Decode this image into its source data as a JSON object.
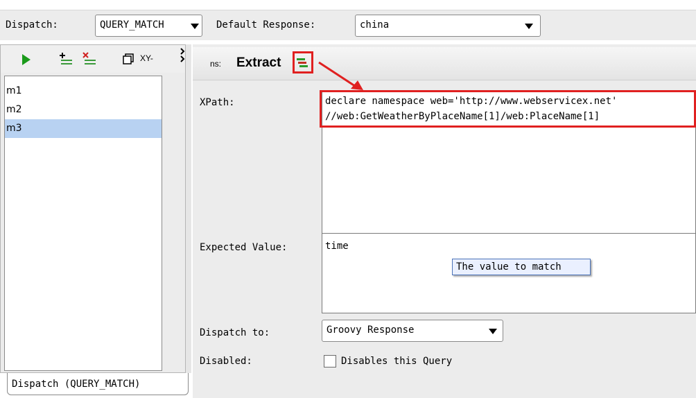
{
  "top": {
    "dispatch_label": "Dispatch:",
    "dispatch_value": "QUERY_MATCH",
    "default_response_label": "Default Response:",
    "default_response_value": "china"
  },
  "left_toolbar": {
    "xy_label": "XY-"
  },
  "list": {
    "items": [
      {
        "label": "m1",
        "selected": false
      },
      {
        "label": "m2",
        "selected": false
      },
      {
        "label": "m3",
        "selected": true
      }
    ]
  },
  "bottom_tab": {
    "label": "Dispatch (QUERY_MATCH)"
  },
  "extract_toolbar": {
    "ns_label": "ns:",
    "extract_label": "Extract"
  },
  "form": {
    "xpath_label": "XPath:",
    "xpath_line1": "declare namespace web='http://www.webservicex.net'",
    "xpath_line2": "//web:GetWeatherByPlaceName[1]/web:PlaceName[1]",
    "expected_label": "Expected Value:",
    "expected_value": "time",
    "tooltip": "The value to match",
    "dispatch_to_label": "Dispatch to:",
    "dispatch_to_value": "Groovy Response",
    "disabled_label": "Disabled:",
    "disabled_checkbox_label": "Disables this Query",
    "disabled_checked": false
  },
  "colors": {
    "highlight": "#e02020",
    "selection": "#b8d2f2",
    "scroll_thumb": "#3b6fbf"
  }
}
